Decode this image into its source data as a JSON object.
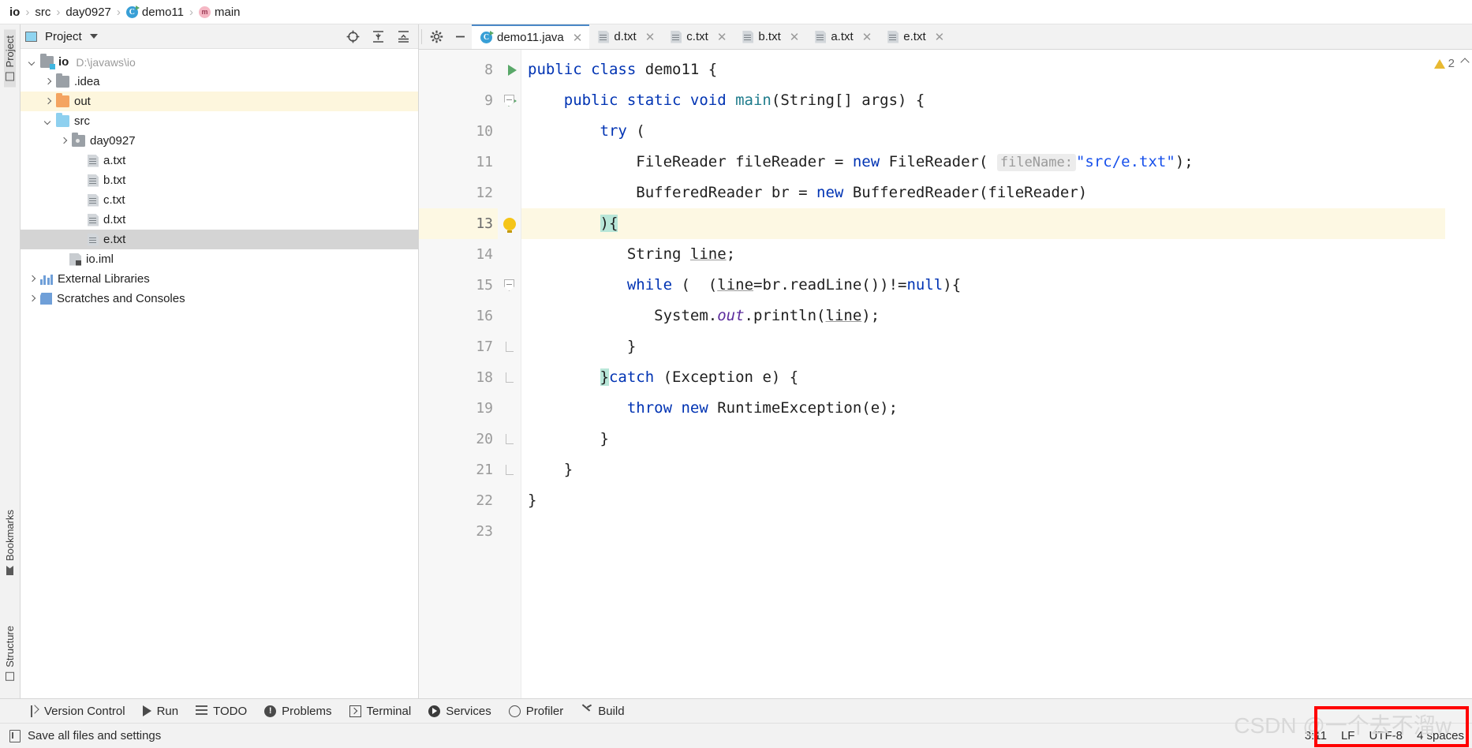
{
  "breadcrumb": {
    "items": [
      {
        "label": "io",
        "icon": "none",
        "bold": true
      },
      {
        "label": "src",
        "icon": "none",
        "bold": false
      },
      {
        "label": "day0927",
        "icon": "none",
        "bold": false
      },
      {
        "label": "demo11",
        "icon": "class-icon",
        "bold": false
      },
      {
        "label": "main",
        "icon": "method-icon",
        "bold": false
      }
    ],
    "separator": "›"
  },
  "left_strip": {
    "project_tab": "Project",
    "bookmarks_tab": "Bookmarks",
    "structure_tab": "Structure"
  },
  "project_panel": {
    "title": "Project",
    "tree": [
      {
        "label": "io",
        "path": "D:\\javaws\\io",
        "indent": 0,
        "arrow": "down",
        "icon": "module-folder-icon",
        "bold": true,
        "state": "normal"
      },
      {
        "label": ".idea",
        "path": "",
        "indent": 1,
        "arrow": "right",
        "icon": "folder-grey-icon",
        "bold": false,
        "state": "normal"
      },
      {
        "label": "out",
        "path": "",
        "indent": 1,
        "arrow": "right",
        "icon": "folder-orange-icon",
        "bold": false,
        "state": "highlighted"
      },
      {
        "label": "src",
        "path": "",
        "indent": 1,
        "arrow": "down",
        "icon": "folder-blue-icon",
        "bold": false,
        "state": "normal"
      },
      {
        "label": "day0927",
        "path": "",
        "indent": 2,
        "arrow": "right",
        "icon": "package-icon",
        "bold": false,
        "state": "normal"
      },
      {
        "label": "a.txt",
        "path": "",
        "indent": 3,
        "arrow": "none",
        "icon": "text-file-icon",
        "bold": false,
        "state": "normal"
      },
      {
        "label": "b.txt",
        "path": "",
        "indent": 3,
        "arrow": "none",
        "icon": "text-file-icon",
        "bold": false,
        "state": "normal"
      },
      {
        "label": "c.txt",
        "path": "",
        "indent": 3,
        "arrow": "none",
        "icon": "text-file-icon",
        "bold": false,
        "state": "normal"
      },
      {
        "label": "d.txt",
        "path": "",
        "indent": 3,
        "arrow": "none",
        "icon": "text-file-icon",
        "bold": false,
        "state": "normal"
      },
      {
        "label": "e.txt",
        "path": "",
        "indent": 3,
        "arrow": "none",
        "icon": "text-file-icon",
        "bold": false,
        "state": "selected"
      },
      {
        "label": "io.iml",
        "path": "",
        "indent": 2,
        "arrow": "none",
        "icon": "iml-file-icon",
        "bold": false,
        "state": "normal"
      },
      {
        "label": "External Libraries",
        "path": "",
        "indent": 0,
        "arrow": "right",
        "icon": "libraries-icon",
        "bold": false,
        "state": "normal"
      },
      {
        "label": "Scratches and Consoles",
        "path": "",
        "indent": 0,
        "arrow": "right",
        "icon": "scratches-icon",
        "bold": false,
        "state": "normal"
      }
    ]
  },
  "editor_tabs": [
    {
      "label": "demo11.java",
      "icon": "java-class-icon",
      "active": true
    },
    {
      "label": "d.txt",
      "icon": "text-file-icon",
      "active": false
    },
    {
      "label": "c.txt",
      "icon": "text-file-icon",
      "active": false
    },
    {
      "label": "b.txt",
      "icon": "text-file-icon",
      "active": false
    },
    {
      "label": "a.txt",
      "icon": "text-file-icon",
      "active": false
    },
    {
      "label": "e.txt",
      "icon": "text-file-icon",
      "active": false
    }
  ],
  "editor": {
    "warning_count": "2",
    "line_numbers": [
      "8",
      "9",
      "10",
      "11",
      "12",
      "13",
      "14",
      "15",
      "16",
      "17",
      "18",
      "19",
      "20",
      "21",
      "22",
      "23"
    ],
    "code_lines": [
      "public class demo11 {",
      "    public static void main(String[] args) {",
      "        try (",
      "            FileReader fileReader = new FileReader( fileName: \"src/e.txt\");",
      "            BufferedReader br = new BufferedReader(fileReader)",
      "        ){",
      "           String line;",
      "           while (  (line=br.readLine())!=null){",
      "              System.out.println(line);",
      "           }",
      "        }catch (Exception e) {",
      "           throw new RuntimeException(e);",
      "        }",
      "    }",
      "}",
      ""
    ],
    "parameter_hint": "fileName:",
    "string_literal": "\"src/e.txt\""
  },
  "bottom_toolbar": [
    {
      "label": "Version Control",
      "icon": "version-control-icon"
    },
    {
      "label": "Run",
      "icon": "run-icon"
    },
    {
      "label": "TODO",
      "icon": "todo-icon"
    },
    {
      "label": "Problems",
      "icon": "problems-icon"
    },
    {
      "label": "Terminal",
      "icon": "terminal-icon"
    },
    {
      "label": "Services",
      "icon": "services-icon"
    },
    {
      "label": "Profiler",
      "icon": "profiler-icon"
    },
    {
      "label": "Build",
      "icon": "build-icon"
    }
  ],
  "status_bar": {
    "message": "Save all files and settings",
    "caret_position": "3:11",
    "line_separator": "LF",
    "encoding": "UTF-8",
    "indent": "4 spaces",
    "watermark": "CSDN @一个去不溜w"
  },
  "colors": {
    "accent_blue": "#4a88c7",
    "keyword": "#0033b3",
    "string": "#1750eb",
    "warning": "#e8b931",
    "red_box": "#ff0000",
    "selection": "#d4d4d4"
  }
}
